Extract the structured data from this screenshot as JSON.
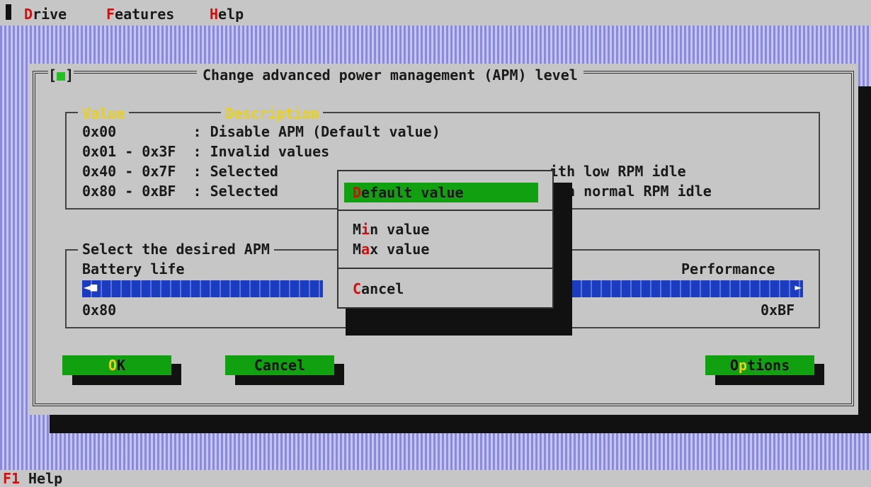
{
  "menubar": {
    "items": [
      {
        "hot": "D",
        "rest": "rive"
      },
      {
        "hot": "F",
        "rest": "eatures"
      },
      {
        "hot": "H",
        "rest": "elp"
      }
    ]
  },
  "dialog": {
    "title": "Change advanced power management (APM) level",
    "close": {
      "left": "[",
      "mid": "■",
      "right": "]"
    },
    "value_group": {
      "header_value": "Value",
      "header_description": "Description",
      "rows": [
        {
          "value": "0x00         ",
          "desc": ": Disable APM (Default value)"
        },
        {
          "value": "0x01 - 0x3F  ",
          "desc": ": Invalid values"
        },
        {
          "value": "0x40 - 0x7F  ",
          "desc": ": Selected"
        },
        {
          "value": "0x80 - 0xBF  ",
          "desc": ": Selected"
        }
      ],
      "tails": [
        "ith low RPM idle",
        "ith normal RPM idle"
      ]
    },
    "select_group": {
      "label": "Select the desired APM",
      "left_label": "Battery life",
      "right_label": "Performance",
      "min_value": "0x80",
      "max_value": "0xBF",
      "left_arrow": "◄■",
      "right_arrow": "►"
    },
    "buttons": {
      "ok": {
        "hot": "O",
        "rest": "K"
      },
      "cancel": "Cancel",
      "options": {
        "pre": "O",
        "hot": "p",
        "rest": "tions"
      }
    }
  },
  "popup": {
    "default": {
      "hot": "D",
      "rest": "efault value"
    },
    "min": {
      "pre": "M",
      "hot": "i",
      "rest": "n value"
    },
    "max": {
      "pre": "M",
      "hot": "a",
      "rest": "x value"
    },
    "cancel": {
      "hot": "C",
      "rest": "ancel"
    }
  },
  "statusbar": {
    "key": "F1",
    "text": "Help"
  },
  "colors": {
    "accent_green": "#10a010",
    "hotkey_red": "#cc1010",
    "slider_blue": "#1c3cbf",
    "label_yellow": "#e8d020"
  }
}
